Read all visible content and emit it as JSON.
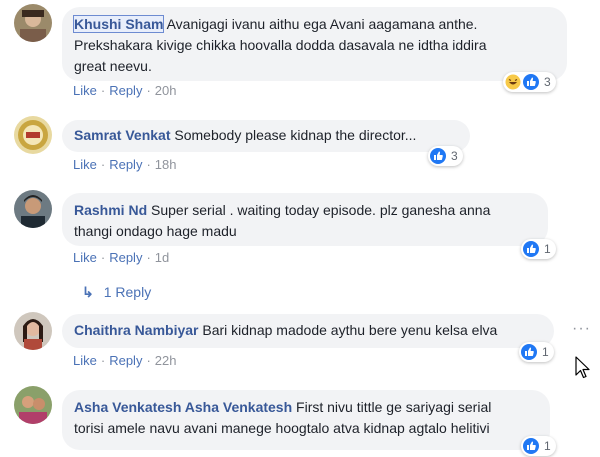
{
  "comments": [
    {
      "author": "Khushi Sham",
      "text": "Avanigagi ivanu aithu ega Avani aagamana anthe. Prekshakara kivige chikka hoovalla dodda dasavala ne idtha iddira great neevu.",
      "line1": "Avanigagi ivanu aithu ega Avani aagamana anthe.",
      "line2": "Prekshakara kivige chikka hoovalla dodda dasavala ne idtha iddira",
      "line3": "great neevu.",
      "like": "Like",
      "reply": "Reply",
      "time": "20h",
      "reaction_count": "3",
      "reactions": [
        "haha-icon",
        "like-icon"
      ]
    },
    {
      "author": "Samrat Venkat",
      "text": "Somebody please kidnap the director...",
      "like": "Like",
      "reply": "Reply",
      "time": "18h",
      "reaction_count": "3",
      "reactions": [
        "like-icon"
      ]
    },
    {
      "author": "Rashmi Nd",
      "line1": "Super serial . waiting today episode. plz ganesha anna",
      "line2": "thangi ondago hage madu",
      "like": "Like",
      "reply": "Reply",
      "time": "1d",
      "reaction_count": "1",
      "reactions": [
        "like-icon"
      ],
      "replies_label": "1 Reply"
    },
    {
      "author": "Chaithra Nambiyar",
      "text": "Bari kidnap madode aythu bere yenu kelsa elva",
      "like": "Like",
      "reply": "Reply",
      "time": "22h",
      "reaction_count": "1",
      "reactions": [
        "like-icon"
      ]
    },
    {
      "author": "Asha Venkatesh Asha Venkatesh",
      "line1": "First nivu tittle ge sariyagi serial",
      "line2": "torisi amele navu avani manege hoogtalo atva kidnap agtalo helitivi",
      "reaction_count": "1",
      "reactions": [
        "like-icon"
      ]
    }
  ],
  "colors": {
    "author": "#385898",
    "bubble": "#f2f3f5",
    "link": "#4b72b6",
    "meta": "#90949c",
    "like_blue": "#2078f4"
  }
}
